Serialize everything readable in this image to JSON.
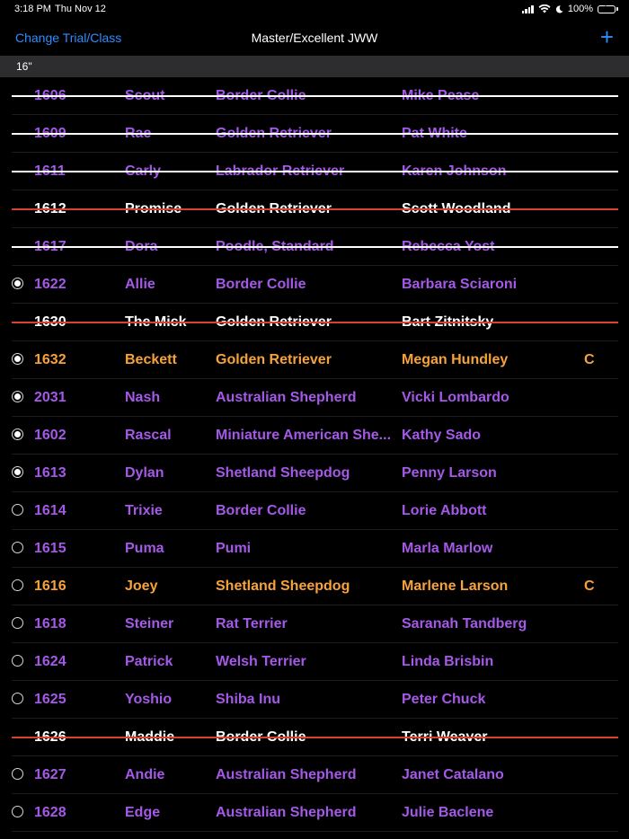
{
  "status_bar": {
    "time": "3:18 PM",
    "date": "Thu Nov 12",
    "battery": "100%"
  },
  "nav": {
    "back_label": "Change Trial/Class",
    "title": "Master/Excellent JWW",
    "add_label": "+"
  },
  "section": {
    "header": "16\""
  },
  "colors": {
    "purple": "#a559e8",
    "orange": "#f7a23a",
    "white": "#ffffff",
    "strike_white": "#ffffff",
    "strike_red": "#d8442b",
    "link_blue": "#2f8cff"
  },
  "rows": [
    {
      "number": "1606",
      "dog": "Scout",
      "breed": "Border Collie",
      "handler": "Mike Pease",
      "flag": "",
      "radio": "none",
      "color": "purple",
      "strike": "white"
    },
    {
      "number": "1609",
      "dog": "Rae",
      "breed": "Golden Retriever",
      "handler": "Pat White",
      "flag": "",
      "radio": "none",
      "color": "purple",
      "strike": "white"
    },
    {
      "number": "1611",
      "dog": "Carly",
      "breed": "Labrador Retriever",
      "handler": "Karen Johnson",
      "flag": "",
      "radio": "none",
      "color": "purple",
      "strike": "white"
    },
    {
      "number": "1612",
      "dog": "Promise",
      "breed": "Golden Retriever",
      "handler": "Scott  Woodland",
      "flag": "",
      "radio": "none",
      "color": "white",
      "strike": "red"
    },
    {
      "number": "1617",
      "dog": "Dora",
      "breed": "Poodle, Standard",
      "handler": "Rebecca Yost",
      "flag": "",
      "radio": "none",
      "color": "purple",
      "strike": "white"
    },
    {
      "number": "1622",
      "dog": "Allie",
      "breed": "Border Collie",
      "handler": "Barbara Sciaroni",
      "flag": "",
      "radio": "on",
      "color": "purple",
      "strike": "none"
    },
    {
      "number": "1630",
      "dog": "The Mick",
      "breed": "Golden Retriever",
      "handler": "Bart Zitnitsky",
      "flag": "",
      "radio": "none",
      "color": "white",
      "strike": "red"
    },
    {
      "number": "1632",
      "dog": "Beckett",
      "breed": "Golden Retriever",
      "handler": "Megan Hundley",
      "flag": "C",
      "radio": "on",
      "color": "orange",
      "strike": "none"
    },
    {
      "number": "2031",
      "dog": "Nash",
      "breed": "Australian Shepherd",
      "handler": "Vicki Lombardo",
      "flag": "",
      "radio": "on",
      "color": "purple",
      "strike": "none"
    },
    {
      "number": "1602",
      "dog": "Rascal",
      "breed": "Miniature American She...",
      "handler": "Kathy Sado",
      "flag": "",
      "radio": "on",
      "color": "purple",
      "strike": "none"
    },
    {
      "number": "1613",
      "dog": "Dylan",
      "breed": "Shetland Sheepdog",
      "handler": "Penny Larson",
      "flag": "",
      "radio": "on",
      "color": "purple",
      "strike": "none"
    },
    {
      "number": "1614",
      "dog": "Trixie",
      "breed": "Border Collie",
      "handler": "Lorie Abbott",
      "flag": "",
      "radio": "off",
      "color": "purple",
      "strike": "none"
    },
    {
      "number": "1615",
      "dog": "Puma",
      "breed": "Pumi",
      "handler": "Marla Marlow",
      "flag": "",
      "radio": "off",
      "color": "purple",
      "strike": "none"
    },
    {
      "number": "1616",
      "dog": "Joey",
      "breed": "Shetland Sheepdog",
      "handler": "Marlene Larson",
      "flag": "C",
      "radio": "off",
      "color": "orange",
      "strike": "none"
    },
    {
      "number": "1618",
      "dog": "Steiner",
      "breed": "Rat Terrier",
      "handler": "Saranah Tandberg",
      "flag": "",
      "radio": "off",
      "color": "purple",
      "strike": "none"
    },
    {
      "number": "1624",
      "dog": "Patrick",
      "breed": "Welsh Terrier",
      "handler": "Linda Brisbin",
      "flag": "",
      "radio": "off",
      "color": "purple",
      "strike": "none"
    },
    {
      "number": "1625",
      "dog": "Yoshio",
      "breed": "Shiba Inu",
      "handler": "Peter Chuck",
      "flag": "",
      "radio": "off",
      "color": "purple",
      "strike": "none"
    },
    {
      "number": "1626",
      "dog": "Maddie",
      "breed": "Border Collie",
      "handler": "Terri Weaver",
      "flag": "",
      "radio": "none",
      "color": "white",
      "strike": "red"
    },
    {
      "number": "1627",
      "dog": "Andie",
      "breed": "Australian Shepherd",
      "handler": "Janet Catalano",
      "flag": "",
      "radio": "off",
      "color": "purple",
      "strike": "none"
    },
    {
      "number": "1628",
      "dog": "Edge",
      "breed": "Australian Shepherd",
      "handler": "Julie Baclene",
      "flag": "",
      "radio": "off",
      "color": "purple",
      "strike": "none"
    }
  ]
}
